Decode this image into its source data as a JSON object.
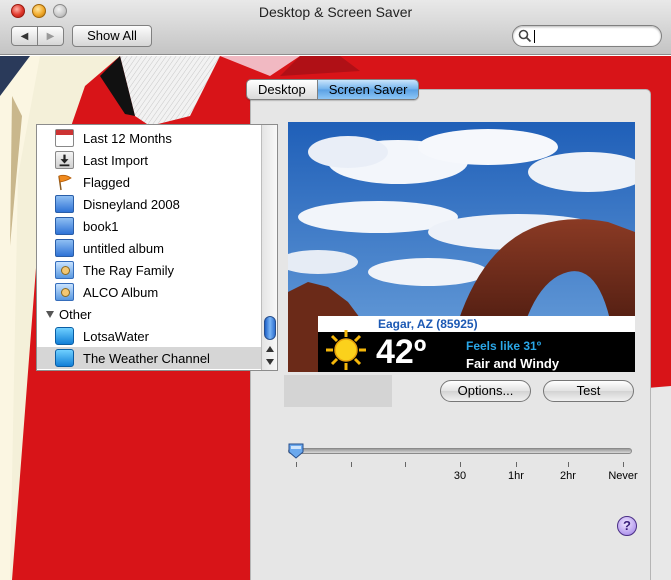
{
  "window": {
    "title": "Desktop & Screen Saver"
  },
  "toolbar": {
    "back_icon": "left-arrow",
    "forward_icon": "right-arrow",
    "show_all_label": "Show All",
    "search": {
      "value": "",
      "placeholder": ""
    }
  },
  "tabs": [
    {
      "label": "Desktop",
      "active": false
    },
    {
      "label": "Screen Saver",
      "active": true
    }
  ],
  "source_list": {
    "items": [
      {
        "label": "Last 12 Months",
        "icon": "calendar-icon"
      },
      {
        "label": "Last Import",
        "icon": "import-icon"
      },
      {
        "label": "Flagged",
        "icon": "flag-icon"
      },
      {
        "label": "Disneyland 2008",
        "icon": "album-icon"
      },
      {
        "label": "book1",
        "icon": "album-icon"
      },
      {
        "label": "untitled album",
        "icon": "album-icon"
      },
      {
        "label": "The Ray Family",
        "icon": "smart-album-icon"
      },
      {
        "label": "ALCO Album",
        "icon": "smart-album-icon"
      }
    ],
    "group_label": "Other",
    "other_items": [
      {
        "label": "LotsaWater",
        "icon": "screensaver-icon",
        "selected": false
      },
      {
        "label": "The Weather Channel",
        "icon": "screensaver-icon",
        "selected": true
      }
    ]
  },
  "preview": {
    "location": "Eagar, AZ (85925)",
    "temperature": "42º",
    "feels_like": "Feels like 31º",
    "condition": "Fair and Windy",
    "icon": "sun-icon"
  },
  "buttons": {
    "options_label": "Options...",
    "test_label": "Test"
  },
  "start_slider": {
    "tick_labels": [
      "30",
      "1hr",
      "2hr",
      "Never"
    ],
    "value_fraction": 0.0
  },
  "help_label": "?",
  "colors": {
    "selection_blue": "#5aa0e3",
    "weather_blue": "#2aa7e8",
    "background_red": "#e0141a"
  }
}
